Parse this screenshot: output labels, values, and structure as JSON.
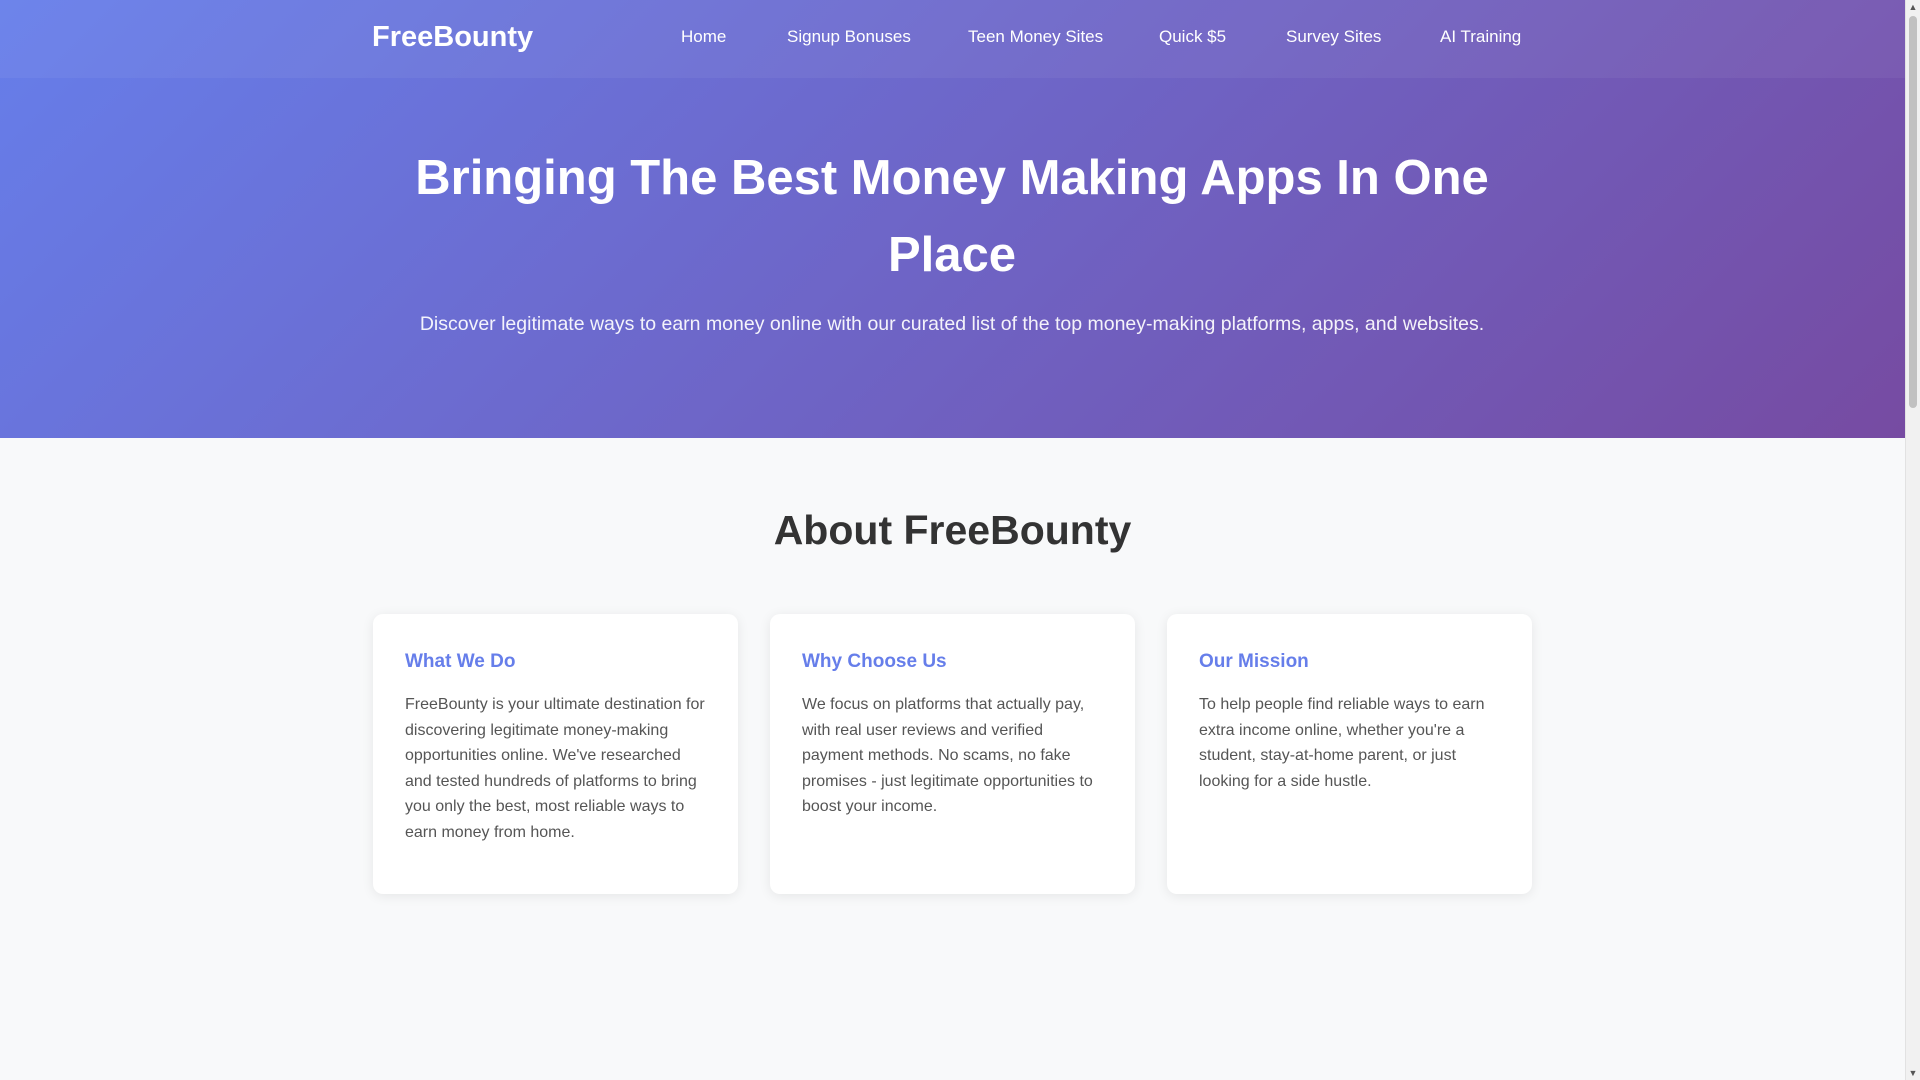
{
  "brand": {
    "name": "FreeBounty"
  },
  "nav": {
    "items": [
      {
        "label": "Home"
      },
      {
        "label": "Signup Bonuses"
      },
      {
        "label": "Teen Money Sites"
      },
      {
        "label": "Quick $5"
      },
      {
        "label": "Survey Sites"
      },
      {
        "label": "AI Training"
      }
    ]
  },
  "hero": {
    "title": "Bringing The Best Money Making Apps In One Place",
    "subtitle": "Discover legitimate ways to earn money online with our curated list of the top money-making platforms, apps, and websites."
  },
  "about": {
    "title": "About FreeBounty",
    "cards": [
      {
        "title": "What We Do",
        "text": "FreeBounty is your ultimate destination for discovering legitimate money-making opportunities online. We've researched and tested hundreds of platforms to bring you only the best, most reliable ways to earn money from home."
      },
      {
        "title": "Why Choose Us",
        "text": "We focus on platforms that actually pay, with real user reviews and verified payment methods. No scams, no fake promises - just legitimate opportunities to boost your income."
      },
      {
        "title": "Our Mission",
        "text": "To help people find reliable ways to earn extra income online, whether you're a student, stay-at-home parent, or just looking for a side hustle."
      }
    ]
  },
  "colors": {
    "gradient_start": "#667eea",
    "gradient_end": "#764ba2",
    "card_heading": "#667eea",
    "page_background": "#f8f9fa"
  },
  "scrollbar": {
    "up_icon": "▲",
    "down_icon": "▼"
  }
}
